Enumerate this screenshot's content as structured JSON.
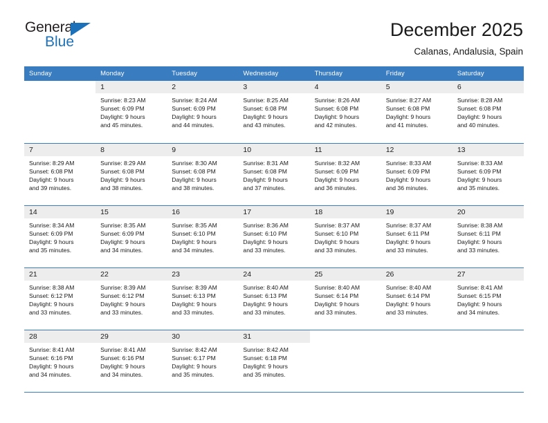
{
  "brand": {
    "name_part1": "General",
    "name_part2": "Blue",
    "triangle_icon": "blue-triangle-icon",
    "accent_color": "#1d71b8"
  },
  "header": {
    "title": "December 2025",
    "subtitle": "Calanas, Andalusia, Spain"
  },
  "theme": {
    "header_row_bg": "#3a7cc0",
    "daynum_bg": "#ededed",
    "grid_line": "#3a7cc0",
    "text": "#1a1a1a"
  },
  "weekday_headers": [
    "Sunday",
    "Monday",
    "Tuesday",
    "Wednesday",
    "Thursday",
    "Friday",
    "Saturday"
  ],
  "labels": {
    "sunrise_prefix": "Sunrise:",
    "sunset_prefix": "Sunset:",
    "daylight_prefix": "Daylight:"
  },
  "weeks": [
    [
      {
        "day": "",
        "sunrise": "",
        "sunset": "",
        "daylight_l1": "",
        "daylight_l2": ""
      },
      {
        "day": "1",
        "sunrise": "Sunrise: 8:23 AM",
        "sunset": "Sunset: 6:09 PM",
        "daylight_l1": "Daylight: 9 hours",
        "daylight_l2": "and 45 minutes."
      },
      {
        "day": "2",
        "sunrise": "Sunrise: 8:24 AM",
        "sunset": "Sunset: 6:09 PM",
        "daylight_l1": "Daylight: 9 hours",
        "daylight_l2": "and 44 minutes."
      },
      {
        "day": "3",
        "sunrise": "Sunrise: 8:25 AM",
        "sunset": "Sunset: 6:08 PM",
        "daylight_l1": "Daylight: 9 hours",
        "daylight_l2": "and 43 minutes."
      },
      {
        "day": "4",
        "sunrise": "Sunrise: 8:26 AM",
        "sunset": "Sunset: 6:08 PM",
        "daylight_l1": "Daylight: 9 hours",
        "daylight_l2": "and 42 minutes."
      },
      {
        "day": "5",
        "sunrise": "Sunrise: 8:27 AM",
        "sunset": "Sunset: 6:08 PM",
        "daylight_l1": "Daylight: 9 hours",
        "daylight_l2": "and 41 minutes."
      },
      {
        "day": "6",
        "sunrise": "Sunrise: 8:28 AM",
        "sunset": "Sunset: 6:08 PM",
        "daylight_l1": "Daylight: 9 hours",
        "daylight_l2": "and 40 minutes."
      }
    ],
    [
      {
        "day": "7",
        "sunrise": "Sunrise: 8:29 AM",
        "sunset": "Sunset: 6:08 PM",
        "daylight_l1": "Daylight: 9 hours",
        "daylight_l2": "and 39 minutes."
      },
      {
        "day": "8",
        "sunrise": "Sunrise: 8:29 AM",
        "sunset": "Sunset: 6:08 PM",
        "daylight_l1": "Daylight: 9 hours",
        "daylight_l2": "and 38 minutes."
      },
      {
        "day": "9",
        "sunrise": "Sunrise: 8:30 AM",
        "sunset": "Sunset: 6:08 PM",
        "daylight_l1": "Daylight: 9 hours",
        "daylight_l2": "and 38 minutes."
      },
      {
        "day": "10",
        "sunrise": "Sunrise: 8:31 AM",
        "sunset": "Sunset: 6:08 PM",
        "daylight_l1": "Daylight: 9 hours",
        "daylight_l2": "and 37 minutes."
      },
      {
        "day": "11",
        "sunrise": "Sunrise: 8:32 AM",
        "sunset": "Sunset: 6:09 PM",
        "daylight_l1": "Daylight: 9 hours",
        "daylight_l2": "and 36 minutes."
      },
      {
        "day": "12",
        "sunrise": "Sunrise: 8:33 AM",
        "sunset": "Sunset: 6:09 PM",
        "daylight_l1": "Daylight: 9 hours",
        "daylight_l2": "and 36 minutes."
      },
      {
        "day": "13",
        "sunrise": "Sunrise: 8:33 AM",
        "sunset": "Sunset: 6:09 PM",
        "daylight_l1": "Daylight: 9 hours",
        "daylight_l2": "and 35 minutes."
      }
    ],
    [
      {
        "day": "14",
        "sunrise": "Sunrise: 8:34 AM",
        "sunset": "Sunset: 6:09 PM",
        "daylight_l1": "Daylight: 9 hours",
        "daylight_l2": "and 35 minutes."
      },
      {
        "day": "15",
        "sunrise": "Sunrise: 8:35 AM",
        "sunset": "Sunset: 6:09 PM",
        "daylight_l1": "Daylight: 9 hours",
        "daylight_l2": "and 34 minutes."
      },
      {
        "day": "16",
        "sunrise": "Sunrise: 8:35 AM",
        "sunset": "Sunset: 6:10 PM",
        "daylight_l1": "Daylight: 9 hours",
        "daylight_l2": "and 34 minutes."
      },
      {
        "day": "17",
        "sunrise": "Sunrise: 8:36 AM",
        "sunset": "Sunset: 6:10 PM",
        "daylight_l1": "Daylight: 9 hours",
        "daylight_l2": "and 33 minutes."
      },
      {
        "day": "18",
        "sunrise": "Sunrise: 8:37 AM",
        "sunset": "Sunset: 6:10 PM",
        "daylight_l1": "Daylight: 9 hours",
        "daylight_l2": "and 33 minutes."
      },
      {
        "day": "19",
        "sunrise": "Sunrise: 8:37 AM",
        "sunset": "Sunset: 6:11 PM",
        "daylight_l1": "Daylight: 9 hours",
        "daylight_l2": "and 33 minutes."
      },
      {
        "day": "20",
        "sunrise": "Sunrise: 8:38 AM",
        "sunset": "Sunset: 6:11 PM",
        "daylight_l1": "Daylight: 9 hours",
        "daylight_l2": "and 33 minutes."
      }
    ],
    [
      {
        "day": "21",
        "sunrise": "Sunrise: 8:38 AM",
        "sunset": "Sunset: 6:12 PM",
        "daylight_l1": "Daylight: 9 hours",
        "daylight_l2": "and 33 minutes."
      },
      {
        "day": "22",
        "sunrise": "Sunrise: 8:39 AM",
        "sunset": "Sunset: 6:12 PM",
        "daylight_l1": "Daylight: 9 hours",
        "daylight_l2": "and 33 minutes."
      },
      {
        "day": "23",
        "sunrise": "Sunrise: 8:39 AM",
        "sunset": "Sunset: 6:13 PM",
        "daylight_l1": "Daylight: 9 hours",
        "daylight_l2": "and 33 minutes."
      },
      {
        "day": "24",
        "sunrise": "Sunrise: 8:40 AM",
        "sunset": "Sunset: 6:13 PM",
        "daylight_l1": "Daylight: 9 hours",
        "daylight_l2": "and 33 minutes."
      },
      {
        "day": "25",
        "sunrise": "Sunrise: 8:40 AM",
        "sunset": "Sunset: 6:14 PM",
        "daylight_l1": "Daylight: 9 hours",
        "daylight_l2": "and 33 minutes."
      },
      {
        "day": "26",
        "sunrise": "Sunrise: 8:40 AM",
        "sunset": "Sunset: 6:14 PM",
        "daylight_l1": "Daylight: 9 hours",
        "daylight_l2": "and 33 minutes."
      },
      {
        "day": "27",
        "sunrise": "Sunrise: 8:41 AM",
        "sunset": "Sunset: 6:15 PM",
        "daylight_l1": "Daylight: 9 hours",
        "daylight_l2": "and 34 minutes."
      }
    ],
    [
      {
        "day": "28",
        "sunrise": "Sunrise: 8:41 AM",
        "sunset": "Sunset: 6:16 PM",
        "daylight_l1": "Daylight: 9 hours",
        "daylight_l2": "and 34 minutes."
      },
      {
        "day": "29",
        "sunrise": "Sunrise: 8:41 AM",
        "sunset": "Sunset: 6:16 PM",
        "daylight_l1": "Daylight: 9 hours",
        "daylight_l2": "and 34 minutes."
      },
      {
        "day": "30",
        "sunrise": "Sunrise: 8:42 AM",
        "sunset": "Sunset: 6:17 PM",
        "daylight_l1": "Daylight: 9 hours",
        "daylight_l2": "and 35 minutes."
      },
      {
        "day": "31",
        "sunrise": "Sunrise: 8:42 AM",
        "sunset": "Sunset: 6:18 PM",
        "daylight_l1": "Daylight: 9 hours",
        "daylight_l2": "and 35 minutes."
      },
      {
        "day": "",
        "sunrise": "",
        "sunset": "",
        "daylight_l1": "",
        "daylight_l2": ""
      },
      {
        "day": "",
        "sunrise": "",
        "sunset": "",
        "daylight_l1": "",
        "daylight_l2": ""
      },
      {
        "day": "",
        "sunrise": "",
        "sunset": "",
        "daylight_l1": "",
        "daylight_l2": ""
      }
    ]
  ]
}
